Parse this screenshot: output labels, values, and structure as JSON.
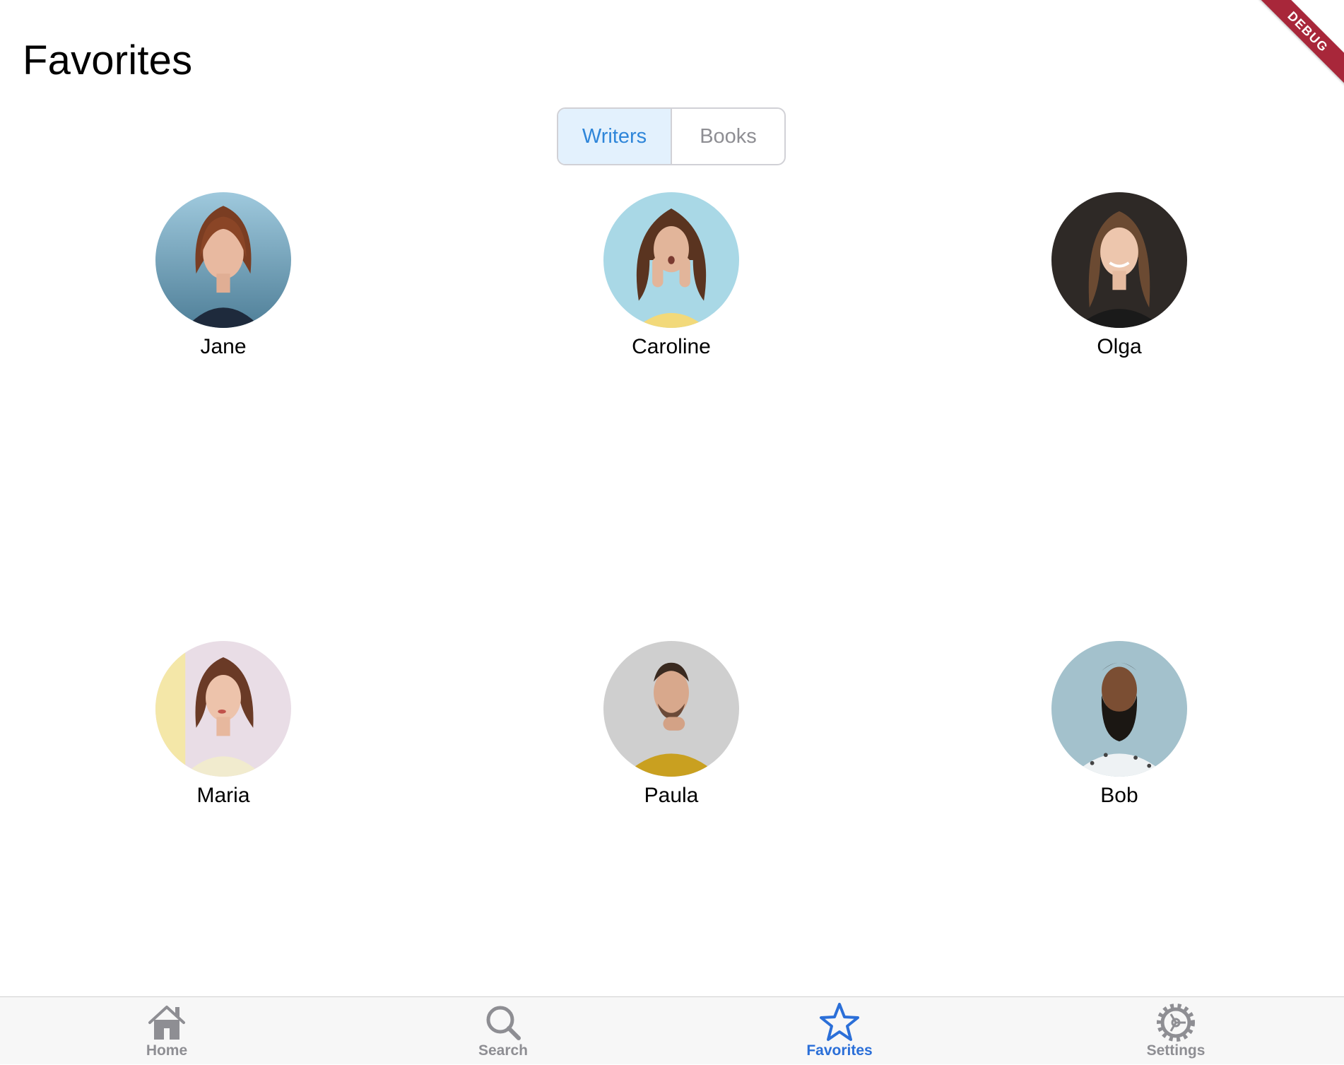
{
  "header": {
    "title": "Favorites",
    "debug_label": "DEBUG"
  },
  "segmented": {
    "options": [
      "Writers",
      "Books"
    ],
    "selected": "Writers"
  },
  "writers": [
    {
      "name": "Jane"
    },
    {
      "name": "Caroline"
    },
    {
      "name": "Olga"
    },
    {
      "name": "Maria"
    },
    {
      "name": "Paula"
    },
    {
      "name": "Bob"
    }
  ],
  "tabbar": {
    "items": [
      {
        "label": "Home",
        "icon": "home-icon"
      },
      {
        "label": "Search",
        "icon": "search-icon"
      },
      {
        "label": "Favorites",
        "icon": "star-icon"
      },
      {
        "label": "Settings",
        "icon": "gear-icon"
      }
    ],
    "active": "Favorites",
    "active_color": "#2b6fd8",
    "inactive_color": "#8e8e93"
  },
  "colors": {
    "segment_active_bg": "#e3f1fd",
    "segment_active_text": "#2f86d9",
    "debug_banner": "#a8273a"
  }
}
